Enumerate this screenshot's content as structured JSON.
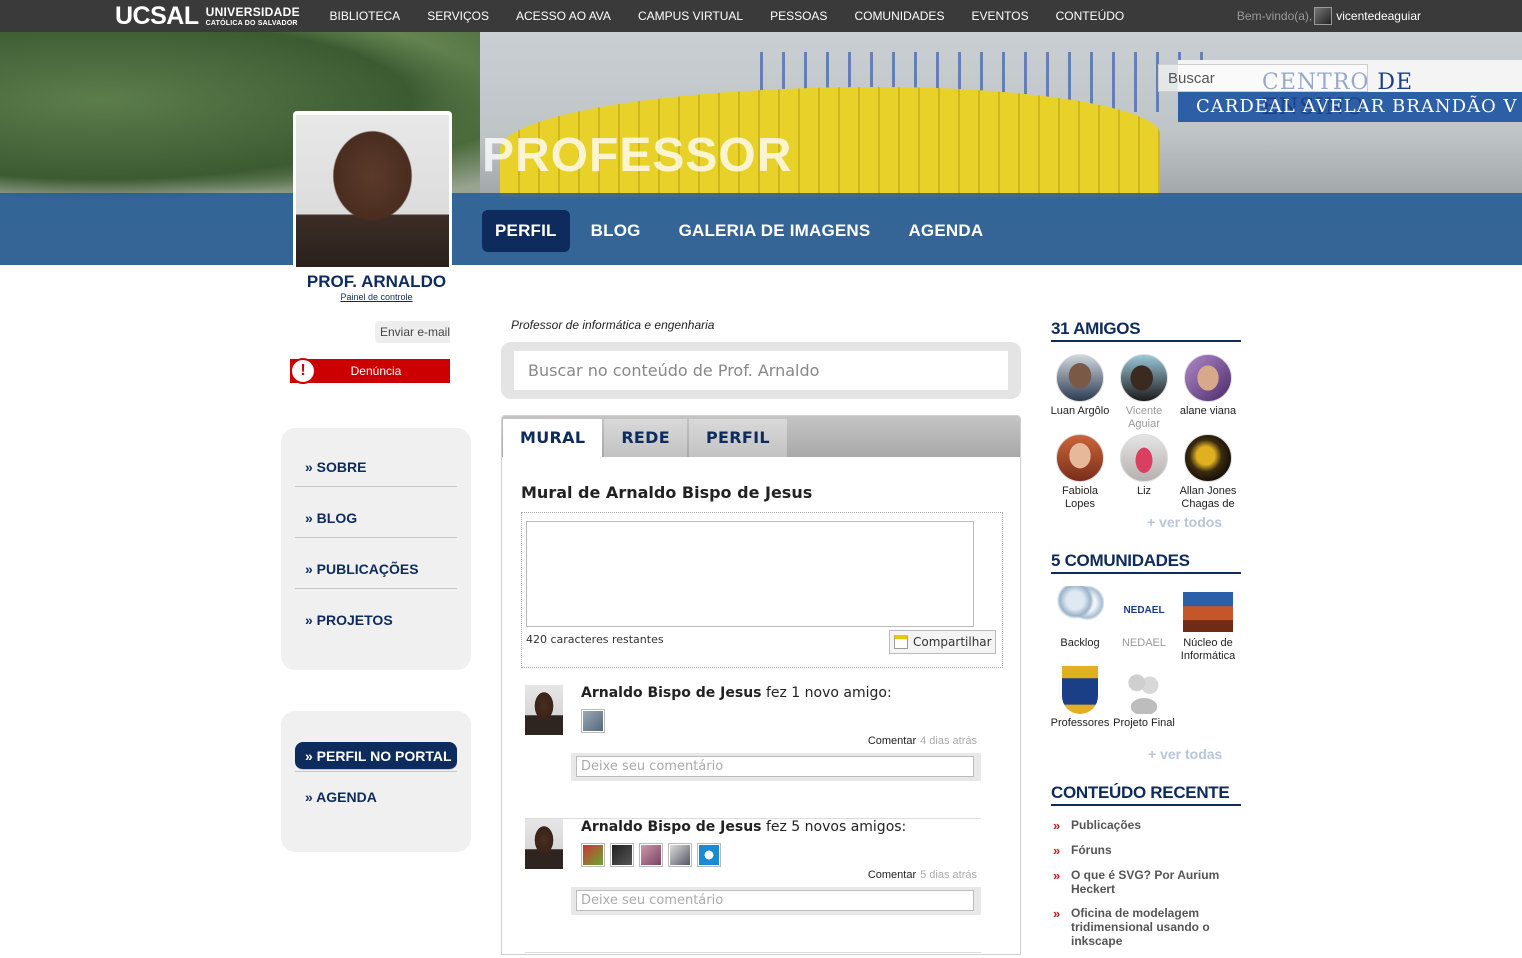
{
  "topbar": {
    "logo_main": "UCSAL",
    "logo_line1": "UNIVERSIDADE",
    "logo_line2": "CATÓLICA DO SALVADOR",
    "nav": [
      "BIBLIOTECA",
      "SERVIÇOS",
      "ACESSO AO AVA",
      "CAMPUS VIRTUAL",
      "PESSOAS",
      "COMUNIDADES",
      "EVENTOS",
      "CONTEÚDO"
    ],
    "welcome": "Bem-vindo(a),",
    "user": "vicentedeaguiar"
  },
  "banner": {
    "title": "PROFESSOR",
    "sign_line1": "CENTRO DE ENSINO",
    "sign_line2": "CARDEAL AVELAR BRANDÃO V",
    "search_placeholder": "Buscar",
    "tabs": [
      "PERFIL",
      "BLOG",
      "GALERIA DE IMAGENS",
      "AGENDA"
    ],
    "active_tab": "PERFIL"
  },
  "profile": {
    "name": "PROF. ARNALDO",
    "control_panel": "Painel de controle",
    "send_email": "Enviar e-mail",
    "report": "Denúncia",
    "report_icon": "!"
  },
  "left_menu": {
    "items": [
      "» SOBRE",
      "» BLOG",
      "» PUBLICAÇÕES",
      "» PROJETOS"
    ],
    "portal_items": [
      "» PERFIL NO PORTAL",
      "» AGENDA"
    ]
  },
  "center": {
    "tagline": "Professor de informática e engenharia",
    "search_placeholder": "Buscar no conteúdo de Prof. Arnaldo",
    "tabs": [
      "MURAL",
      "REDE",
      "PERFIL"
    ],
    "active_tab": "MURAL",
    "mural_title": "Mural de Arnaldo Bispo de Jesus",
    "chars_left": "420 caracteres restantes",
    "share_label": "Compartilhar",
    "activities": [
      {
        "author": "Arnaldo Bispo de Jesus",
        "action": "fez 1 novo amigo:",
        "comment_label": "Comentar",
        "time": "4 dias atrás",
        "comment_placeholder": "Deixe seu comentário",
        "thumbs": 1
      },
      {
        "author": "Arnaldo Bispo de Jesus",
        "action": "fez 5 novos amigos:",
        "comment_label": "Comentar",
        "time": "5 dias atrás",
        "comment_placeholder": "Deixe seu comentário",
        "thumbs": 5
      }
    ]
  },
  "friends": {
    "heading": "31 AMIGOS",
    "list": [
      "Luan Argôlo",
      "Vicente Aguiar",
      "alane viana",
      "Fabiola Lopes",
      "Liz",
      "Allan Jones Chagas de"
    ],
    "see_all": "+ ver todos"
  },
  "communities": {
    "heading": "5 COMUNIDADES",
    "list": [
      "Backlog",
      "NEDAEL",
      "Núcleo de Informática",
      "Professores",
      "Projeto Final"
    ],
    "nedael_logo_text": "NEDAEL",
    "see_all": "+ ver todas"
  },
  "recent": {
    "heading": "CONTEÚDO RECENTE",
    "items": [
      "Publicações",
      "Fóruns",
      "O que é SVG? Por Aurium Heckert",
      "Oficina de modelagem tridimensional usando o inkscape"
    ]
  },
  "colors": {
    "navy": "#0d2b5c",
    "report_red": "#cc0000",
    "topbar": "#3a3a3a",
    "banner_blue": "#215a96"
  }
}
